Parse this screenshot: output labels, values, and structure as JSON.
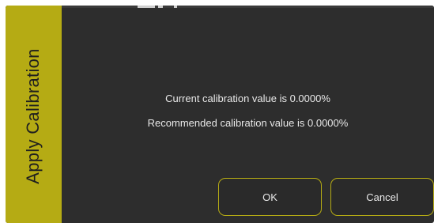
{
  "dialog": {
    "title": "Apply Calibration",
    "current_message": "Current calibration value is 0.0000%",
    "recommended_message": "Recommended calibration value is 0.0000%",
    "ok_label": "OK",
    "cancel_label": "Cancel"
  },
  "colors": {
    "accent": "#b5ab14",
    "background": "#2d2d2d",
    "text": "#e8e8e8"
  }
}
